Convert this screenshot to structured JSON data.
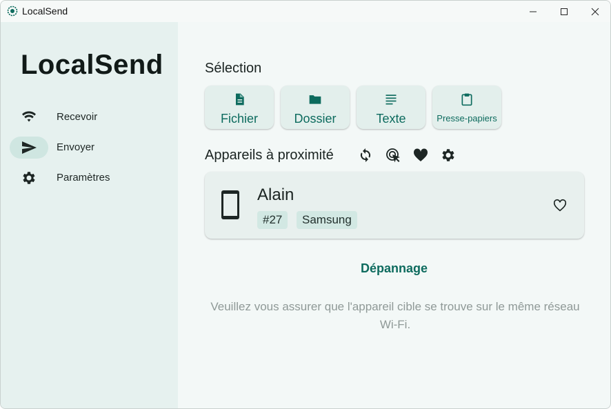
{
  "window": {
    "title": "LocalSend"
  },
  "sidebar": {
    "brand": "LocalSend",
    "items": [
      {
        "label": "Recevoir",
        "icon": "wifi-icon",
        "active": false
      },
      {
        "label": "Envoyer",
        "icon": "send-icon",
        "active": true
      },
      {
        "label": "Paramètres",
        "icon": "gear-icon",
        "active": false
      }
    ]
  },
  "selection": {
    "title": "Sélection",
    "buttons": [
      {
        "label": "Fichier",
        "icon": "file-icon"
      },
      {
        "label": "Dossier",
        "icon": "folder-icon"
      },
      {
        "label": "Texte",
        "icon": "text-icon"
      },
      {
        "label": "Presse-papiers",
        "icon": "clipboard-icon"
      }
    ]
  },
  "nearby": {
    "title": "Appareils à proximité",
    "actions": [
      "refresh-icon",
      "scan-icon",
      "favorites-icon",
      "settings-icon"
    ],
    "devices": [
      {
        "name": "Alain",
        "tags": [
          "#27",
          "Samsung"
        ],
        "icon": "smartphone-icon"
      }
    ]
  },
  "troubleshoot_label": "Dépannage",
  "hint": "Veuillez vous assurer que l'appareil cible se trouve sur le même réseau Wi-Fi.",
  "colors": {
    "accent": "#0d6b5e",
    "sidebar_bg": "#e6f1ef",
    "main_bg": "#f3f8f7",
    "active_pill": "#cfe6e1"
  }
}
